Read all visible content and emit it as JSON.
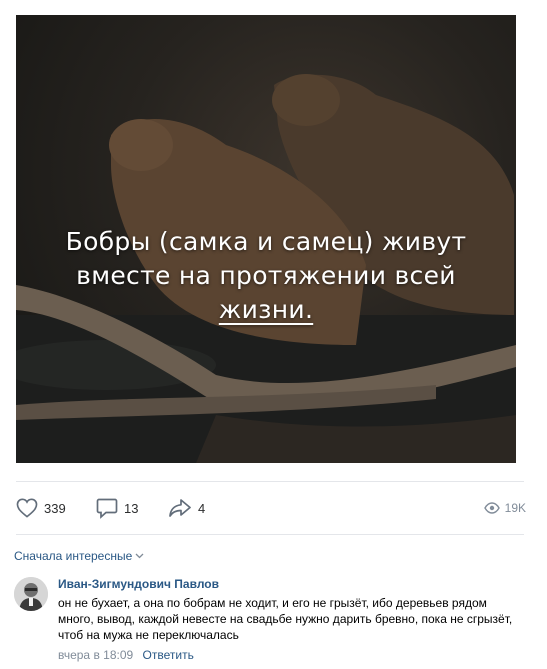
{
  "post": {
    "image_alt": "beavers",
    "caption_line1": "Бобры (самка и самец) живут",
    "caption_line2": "вместе на протяжении всей",
    "caption_line3": "жизни."
  },
  "actions": {
    "likes": "339",
    "comments": "13",
    "shares": "4",
    "views": "19K"
  },
  "comments_section": {
    "sort_label": "Сначала интересные"
  },
  "comment": {
    "author": "Иван-Зигмундович Павлов",
    "text": "он не бухает, а она по бобрам не ходит, и его не грызёт, ибо деревьев рядом много, вывод, каждой невесте на свадьбе нужно дарить бревно, пока не сгрызёт, чтоб на мужа не переключалась",
    "time": "вчера в 18:09",
    "reply_label": "Ответить"
  },
  "colors": {
    "link": "#2a5885",
    "muted": "#818c99",
    "icon": "#626d7a"
  }
}
